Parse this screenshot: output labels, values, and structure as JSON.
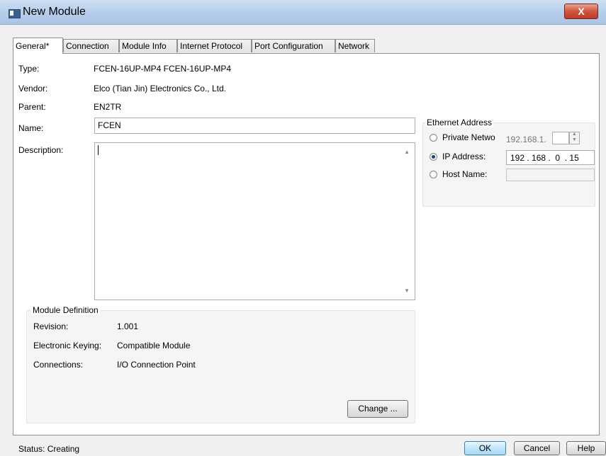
{
  "window": {
    "title": "New Module",
    "close_label": "X"
  },
  "tabs": [
    {
      "label": "General*"
    },
    {
      "label": "Connection"
    },
    {
      "label": "Module Info"
    },
    {
      "label": "Internet Protocol"
    },
    {
      "label": "Port Configuration"
    },
    {
      "label": "Network"
    }
  ],
  "general": {
    "type_label": "Type:",
    "type_value": "FCEN-16UP-MP4 FCEN-16UP-MP4",
    "vendor_label": "Vendor:",
    "vendor_value": "Elco (Tian Jin) Electronics Co., Ltd.",
    "parent_label": "Parent:",
    "parent_value": "EN2TR",
    "name_label": "Name:",
    "name_value": "FCEN",
    "description_label": "Description:",
    "description_value": ""
  },
  "module_definition": {
    "title": "Module Definition",
    "revision_label": "Revision:",
    "revision_value": "1.001",
    "keying_label": "Electronic Keying:",
    "keying_value": "Compatible Module",
    "connections_label": "Connections:",
    "connections_value": "I/O Connection Point",
    "change_button": "Change ..."
  },
  "ethernet": {
    "title": "Ethernet Address",
    "private_label": "Private Netwo",
    "private_value": "192.168.1.",
    "ip_label": "IP Address:",
    "ip_value": "192 . 168 .  0  . 15",
    "host_label": "Host Name:",
    "host_value": "",
    "selected": "IP Address"
  },
  "status": {
    "text": "Status: Creating"
  },
  "buttons": {
    "ok": "OK",
    "cancel": "Cancel",
    "help": "Help"
  }
}
